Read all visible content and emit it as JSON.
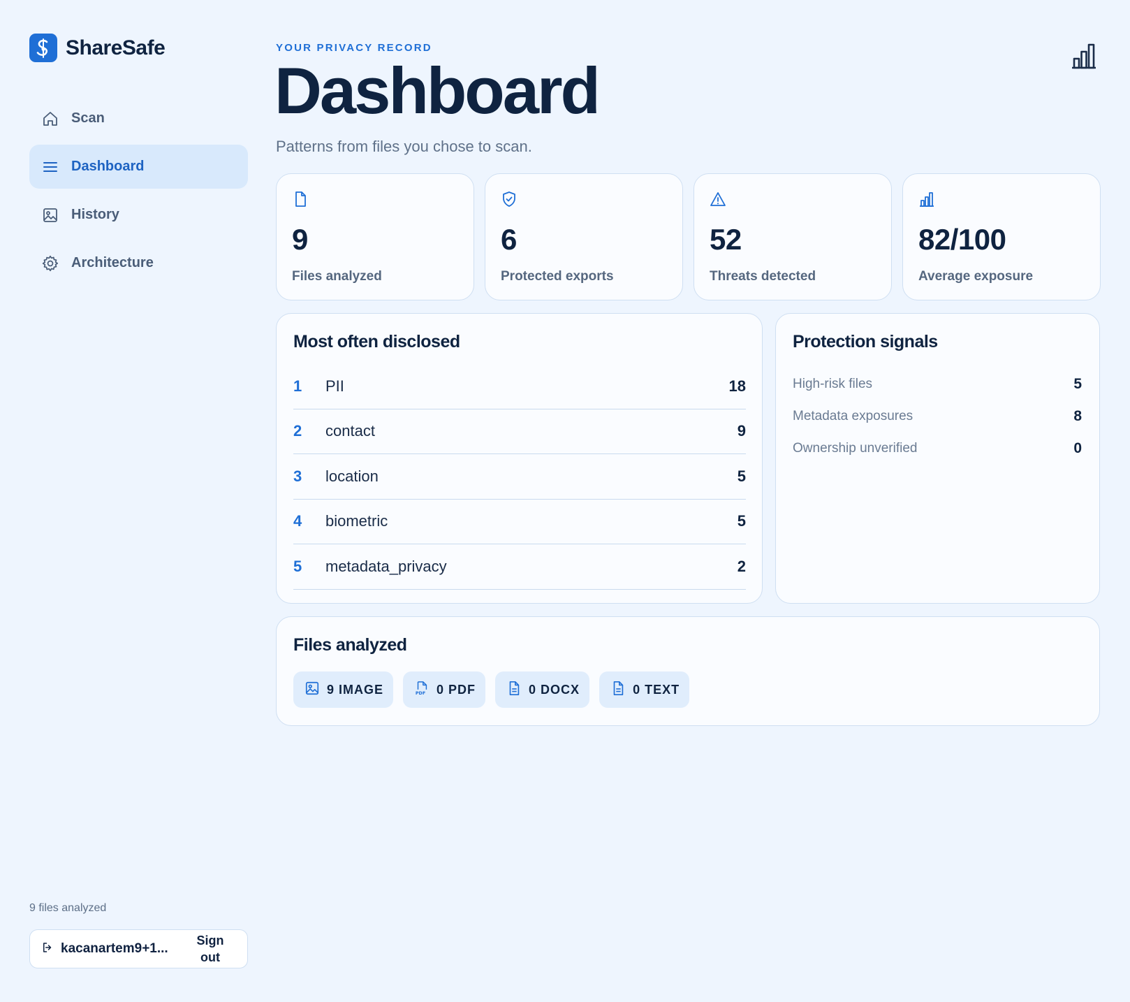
{
  "brand": {
    "name": "ShareSafe",
    "accent": "#1f6fd6"
  },
  "nav": [
    {
      "label": "Scan",
      "icon": "home-icon",
      "active": false
    },
    {
      "label": "Dashboard",
      "icon": "menu-icon",
      "active": true
    },
    {
      "label": "History",
      "icon": "image-icon",
      "active": false
    },
    {
      "label": "Architecture",
      "icon": "gear-icon",
      "active": false
    }
  ],
  "sidebar": {
    "files_note": "9 files analyzed",
    "account_email": "kacanartem9+1...",
    "sign_out": "Sign out"
  },
  "header": {
    "eyebrow": "YOUR PRIVACY RECORD",
    "title": "Dashboard",
    "subtitle": "Patterns from files you chose to scan."
  },
  "stats": [
    {
      "value": "9",
      "label": "Files analyzed",
      "icon": "file-icon"
    },
    {
      "value": "6",
      "label": "Protected exports",
      "icon": "shield-check-icon"
    },
    {
      "value": "52",
      "label": "Threats detected",
      "icon": "warning-icon"
    },
    {
      "value": "82/100",
      "label": "Average exposure",
      "icon": "bar-chart-icon"
    }
  ],
  "disclosed": {
    "title": "Most often disclosed",
    "rows": [
      {
        "rank": "1",
        "name": "PII",
        "count": "18"
      },
      {
        "rank": "2",
        "name": "contact",
        "count": "9"
      },
      {
        "rank": "3",
        "name": "location",
        "count": "5"
      },
      {
        "rank": "4",
        "name": "biometric",
        "count": "5"
      },
      {
        "rank": "5",
        "name": "metadata_privacy",
        "count": "2"
      }
    ]
  },
  "signals": {
    "title": "Protection signals",
    "rows": [
      {
        "label": "High-risk files",
        "value": "5"
      },
      {
        "label": "Metadata exposures",
        "value": "8"
      },
      {
        "label": "Ownership unverified",
        "value": "0"
      }
    ]
  },
  "files": {
    "title": "Files analyzed",
    "chips": [
      {
        "text": "9 IMAGE",
        "icon": "image-icon"
      },
      {
        "text": "0 PDF",
        "icon": "pdf-icon"
      },
      {
        "text": "0 DOCX",
        "icon": "document-icon"
      },
      {
        "text": "0 TEXT",
        "icon": "text-file-icon"
      }
    ]
  }
}
